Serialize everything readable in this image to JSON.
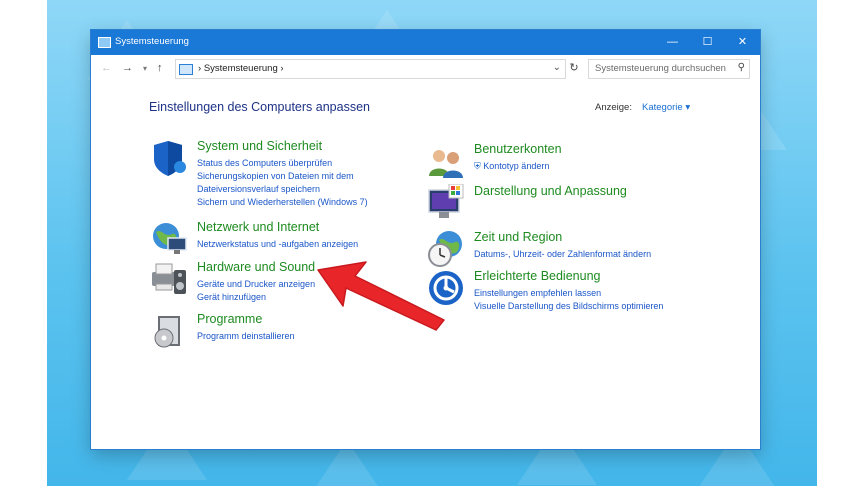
{
  "window": {
    "title": "Systemsteuerung"
  },
  "address": {
    "crumb": "Systemsteuerung",
    "search_placeholder": "Systemsteuerung durchsuchen"
  },
  "main": {
    "heading": "Einstellungen des Computers anpassen",
    "view_label": "Anzeige:",
    "view_value": "Kategorie"
  },
  "categories_left": [
    {
      "title": "System und Sicherheit",
      "links": [
        "Status des Computers überprüfen",
        "Sicherungskopien von Dateien mit dem",
        "Dateiversionsverlauf speichern",
        "Sichern und Wiederherstellen (Windows 7)"
      ],
      "icon": "shield-icon"
    },
    {
      "title": "Netzwerk und Internet",
      "links": [
        "Netzwerkstatus und -aufgaben anzeigen"
      ],
      "icon": "network-globe-icon"
    },
    {
      "title": "Hardware und Sound",
      "links": [
        "Geräte und Drucker anzeigen",
        "Gerät hinzufügen"
      ],
      "icon": "printer-speaker-icon"
    },
    {
      "title": "Programme",
      "links": [
        "Programm deinstallieren"
      ],
      "icon": "programs-disc-icon"
    }
  ],
  "categories_right": [
    {
      "title": "Benutzerkonten",
      "links": [
        "Kontotyp ändern"
      ],
      "icon": "users-icon"
    },
    {
      "title": "Darstellung und Anpassung",
      "links": [],
      "icon": "display-color-icon"
    },
    {
      "title": "Zeit und Region",
      "links": [
        "Datums-, Uhrzeit- oder Zahlenformat ändern"
      ],
      "icon": "clock-globe-icon"
    },
    {
      "title": "Erleichterte Bedienung",
      "links": [
        "Einstellungen empfehlen lassen",
        "Visuelle Darstellung des Bildschirms optimieren"
      ],
      "icon": "ease-of-access-icon"
    }
  ],
  "colors": {
    "category_title": "#1e8b20",
    "link": "#1a56c8",
    "titlebar": "#1a78d7",
    "annotation_arrow": "#e8262a"
  }
}
